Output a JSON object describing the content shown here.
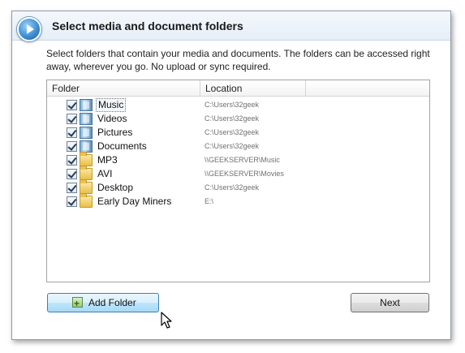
{
  "dialog": {
    "title": "Select media and document folders",
    "instructions": "Select folders that contain your media and documents. The folders can be accessed right away, wherever you go. No upload or sync required.",
    "app_icon": "media-player-icon"
  },
  "folder_list": {
    "columns": [
      "Folder",
      "Location",
      ""
    ],
    "rows": [
      {
        "name": "Music",
        "location": "C:\\Users\\32geek",
        "checked": true,
        "icon": "music-library-icon",
        "selected": true
      },
      {
        "name": "Videos",
        "location": "C:\\Users\\32geek",
        "checked": true,
        "icon": "videos-library-icon",
        "selected": false
      },
      {
        "name": "Pictures",
        "location": "C:\\Users\\32geek",
        "checked": true,
        "icon": "pictures-library-icon",
        "selected": false
      },
      {
        "name": "Documents",
        "location": "C:\\Users\\32geek",
        "checked": true,
        "icon": "documents-library-icon",
        "selected": false
      },
      {
        "name": "MP3",
        "location": "\\\\GEEKSERVER\\Music",
        "checked": true,
        "icon": "folder-icon",
        "selected": false
      },
      {
        "name": "AVI",
        "location": "\\\\GEEKSERVER\\Movies",
        "checked": true,
        "icon": "folder-icon",
        "selected": false
      },
      {
        "name": "Desktop",
        "location": "C:\\Users\\32geek",
        "checked": true,
        "icon": "folder-icon",
        "selected": false
      },
      {
        "name": "Early Day Miners",
        "location": "E:\\",
        "checked": true,
        "icon": "folder-icon",
        "selected": false
      }
    ]
  },
  "buttons": {
    "add_folder": "Add Folder",
    "next": "Next"
  },
  "colors": {
    "accent": "#3c7fb1",
    "header_bg": "#e6eef7",
    "location_text": "#707070"
  }
}
